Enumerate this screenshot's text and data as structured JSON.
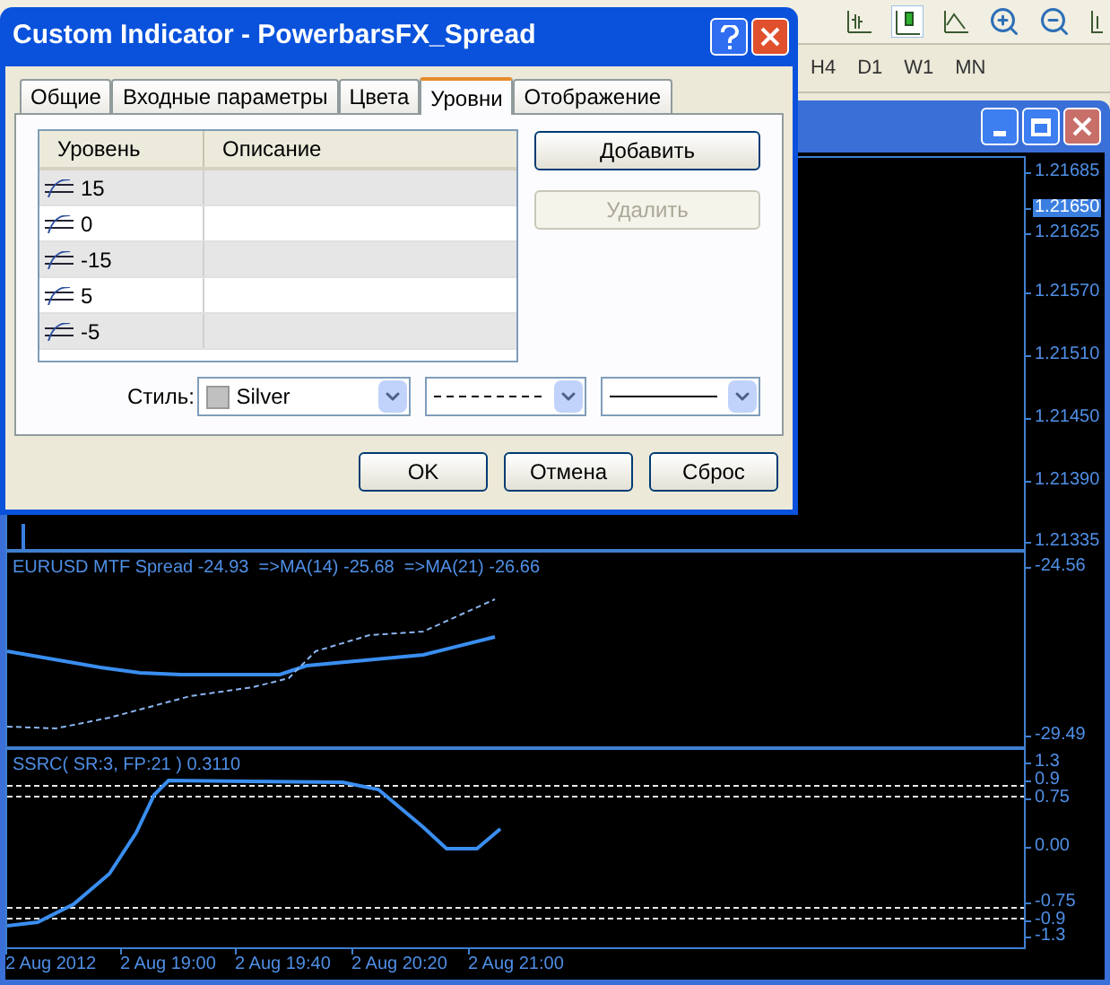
{
  "toolbar": {
    "timeframes": [
      "H4",
      "D1",
      "W1",
      "MN"
    ]
  },
  "chart": {
    "main_pane": {
      "price_labels": [
        "1.21685",
        "1.21625",
        "1.21570",
        "1.21510",
        "1.21450",
        "1.21390",
        "1.21335"
      ],
      "current_price": "1.21650"
    },
    "indicator_panes": [
      {
        "title": "EURUSD MTF Spread -24.93  =>MA(14) -25.68  =>MA(21) -26.66",
        "scale": [
          "-24.56",
          "-29.49"
        ]
      },
      {
        "title": "SSRC( SR:3, FP:21 ) 0.3110",
        "scale": [
          "1.3",
          "0.9",
          "0.75",
          "0.00",
          "-0.75",
          "-0.9",
          "-1.3"
        ]
      }
    ],
    "time_axis": [
      "2 Aug 2012",
      "2 Aug 19:00",
      "2 Aug 19:40",
      "2 Aug 20:20",
      "2 Aug 21:00"
    ]
  },
  "dialog": {
    "title": "Custom Indicator - PowerbarsFX_Spread",
    "tabs": [
      {
        "label": "Общие",
        "selected": false
      },
      {
        "label": "Входные параметры",
        "selected": false
      },
      {
        "label": "Цвета",
        "selected": false
      },
      {
        "label": "Уровни",
        "selected": true
      },
      {
        "label": "Отображение",
        "selected": false
      }
    ],
    "levels_table": {
      "columns": [
        "Уровень",
        "Описание"
      ],
      "rows": [
        {
          "value": "15"
        },
        {
          "value": "0"
        },
        {
          "value": "-15"
        },
        {
          "value": "5"
        },
        {
          "value": "-5"
        }
      ]
    },
    "side_buttons": [
      {
        "label": "Добавить",
        "disabled": false
      },
      {
        "label": "Удалить",
        "disabled": true
      }
    ],
    "style": {
      "label": "Стиль:",
      "color_name": "Silver",
      "color": "#c0c0c0",
      "line_style": {
        "kind": "dashed"
      },
      "line_width": {
        "kind": "thin"
      }
    },
    "footer_buttons": [
      "OK",
      "Отмена",
      "Сброс"
    ]
  }
}
